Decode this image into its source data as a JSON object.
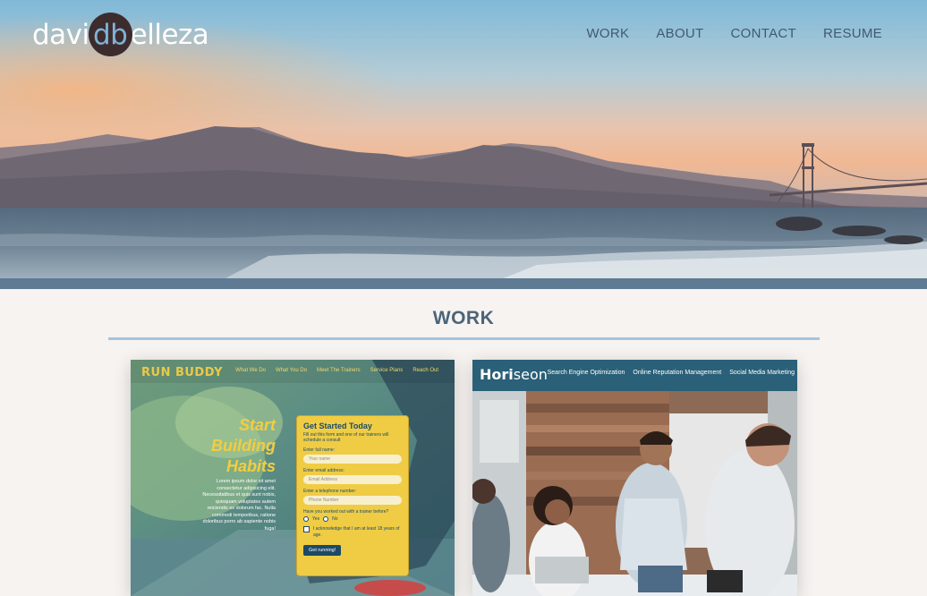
{
  "header": {
    "logo": {
      "left": "davi",
      "mid": "db",
      "right": "elleza"
    },
    "nav": [
      "WORK",
      "ABOUT",
      "CONTACT",
      "RESUME"
    ]
  },
  "work": {
    "title": "WORK",
    "projects": [
      {
        "brand": "RUN BUDDY",
        "nav": [
          "What We Do",
          "What You Do",
          "Meet The Trainers",
          "Service Plans",
          "Reach Out"
        ],
        "headline": [
          "Start",
          "Building",
          "Habits"
        ],
        "copy": "Lorem ipsum dolor sit amet consectetur adipisicing elit. Necessitatibus et quis sunt nobis, quisquam voluptates autem reiciendis ex dolorum fac. Nulla commodi temporibus, ratione doloribus porro ab sapiente nobis fuga!",
        "form": {
          "title": "Get Started Today",
          "subtitle": "Fill out this form and one of our trainers will schedule a consult",
          "name_label": "Enter full name:",
          "name_placeholder": "Your name",
          "email_label": "Enter email address:",
          "email_placeholder": "Email Address",
          "phone_label": "Enter a telephone number:",
          "phone_placeholder": "Phone Number",
          "question": "Have you worked out with a trainer before?",
          "yes": "Yes",
          "no": "No",
          "ack": "I acknowledge that I am at least 18 years of age.",
          "button": "Get running!"
        }
      },
      {
        "brand_a": "Hori",
        "brand_b": "seon",
        "nav": [
          "Search Engine Optimization",
          "Online Reputation Management",
          "Social Media Marketing"
        ]
      }
    ]
  },
  "colors": {
    "accent": "#7fb3d9",
    "nav_text": "#405a72",
    "rule": "#a6c4d9",
    "horiseon_bar": "#2a6078",
    "runbuddy_yellow": "#f0cc44"
  }
}
